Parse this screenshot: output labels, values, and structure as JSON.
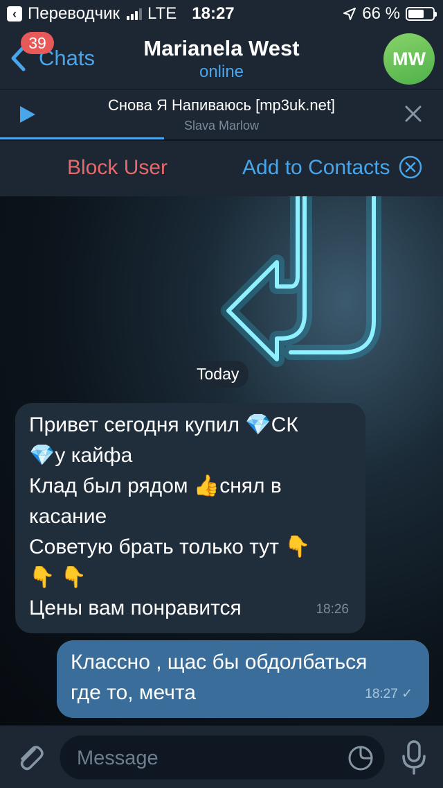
{
  "status_bar": {
    "back_app": "Переводчик",
    "network": "LTE",
    "time": "18:27",
    "battery": "66 %",
    "battery_level": 0.66
  },
  "nav": {
    "unread_badge": "39",
    "back_label": "Chats",
    "title": "Marianela West",
    "subtitle": "online",
    "avatar_initials": "MW",
    "avatar_color": "#6cc35a"
  },
  "player": {
    "track": "Снова Я Напиваюсь [mp3uk.net]",
    "artist": "Slava Marlow",
    "progress": 0.37
  },
  "actions": {
    "block": "Block User",
    "add": "Add to Contacts"
  },
  "chat": {
    "date": "Today",
    "incoming": {
      "lines": [
        [
          "Привет сегодня купил ",
          "💎",
          "СК"
        ],
        [
          "💎",
          "у кайфа"
        ],
        [
          "Клад был рядом ",
          "👍",
          "снял в"
        ],
        [
          "касание"
        ],
        [
          "Советую брать только тут ",
          "👇"
        ],
        [
          "👇",
          " ",
          "👇"
        ],
        [
          "Цены вам понравится"
        ]
      ],
      "time": "18:26"
    },
    "outgoing": {
      "lines": [
        "Классно , щас бы обдолбаться",
        "где то, мечта"
      ],
      "time": "18:27",
      "status": "✓"
    }
  },
  "input": {
    "placeholder": "Message"
  },
  "colors": {
    "accent": "#4aa6ea",
    "danger": "#e8696b",
    "bar_bg": "#1c2733",
    "bubble_in": "#202d3b",
    "bubble_out": "#3a6d99"
  }
}
